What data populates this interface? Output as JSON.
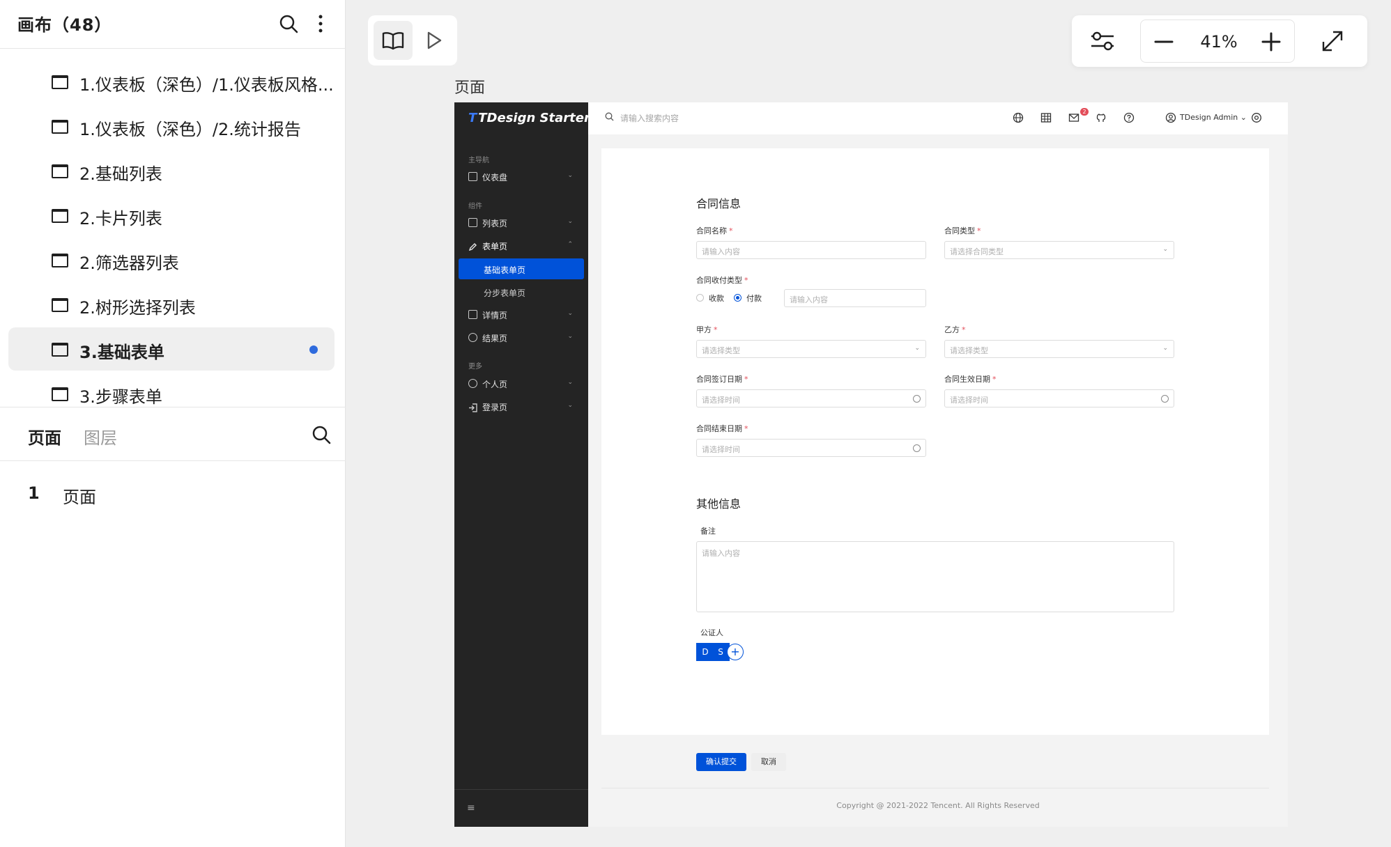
{
  "left_panel": {
    "canvas_title": "画布（48）",
    "canvas_items": [
      {
        "label": "1.仪表板（深色）/1.仪表板风格..."
      },
      {
        "label": "1.仪表板（深色）/2.统计报告"
      },
      {
        "label": "2.基础列表"
      },
      {
        "label": "2.卡片列表"
      },
      {
        "label": "2.筛选器列表"
      },
      {
        "label": "2.树形选择列表"
      },
      {
        "label": "3.基础表单"
      },
      {
        "label": "3.步骤表单"
      }
    ],
    "selected_index": 6,
    "tabs": {
      "pages": "页面",
      "layers": "图层"
    },
    "page_list": [
      {
        "number": "1",
        "name": "页面"
      }
    ]
  },
  "toolbar": {
    "zoom_level": "41%"
  },
  "artboard": {
    "label": "页面",
    "sidebar": {
      "logo_mark": "T",
      "logo_text": "TDesign Starter",
      "group_main": "主导航",
      "group_components": "组件",
      "group_more": "更多",
      "items": {
        "dashboard": "仪表盘",
        "list": "列表页",
        "form": "表单页",
        "form_basic": "基础表单页",
        "form_step": "分步表单页",
        "detail": "详情页",
        "result": "结果页",
        "user": "个人页",
        "login": "登录页"
      }
    },
    "header": {
      "search_placeholder": "请输入搜索内容",
      "notification_count": "2",
      "user_name": "TDesign Admin"
    },
    "form": {
      "contract_section": "合同信息",
      "contract_name_label": "合同名称",
      "contract_name_placeholder": "请输入内容",
      "contract_type_label": "合同类型",
      "contract_type_placeholder": "请选择合同类型",
      "payment_type_label": "合同收付类型",
      "radio_receive": "收款",
      "radio_pay": "付款",
      "payment_amount_placeholder": "请输入内容",
      "party_a_label": "甲方",
      "party_a_placeholder": "请选择类型",
      "party_b_label": "乙方",
      "party_b_placeholder": "请选择类型",
      "sign_date_label": "合同签订日期",
      "sign_date_placeholder": "请选择时间",
      "effective_date_label": "合同生效日期",
      "effective_date_placeholder": "请选择时间",
      "end_date_label": "合同结束日期",
      "end_date_placeholder": "请选择时间",
      "other_section": "其他信息",
      "remark_label": "备注",
      "remark_placeholder": "请输入内容",
      "notary_label": "公证人",
      "notary_avatars": [
        "D",
        "S"
      ],
      "submit": "确认提交",
      "cancel": "取消"
    },
    "footer": "Copyright @ 2021-2022 Tencent. All Rights Reserved"
  },
  "colors": {
    "brand": "#0052d9",
    "accent_dot": "#2f6bdd",
    "sidebar_bg": "#242424",
    "required": "#e34d59"
  }
}
